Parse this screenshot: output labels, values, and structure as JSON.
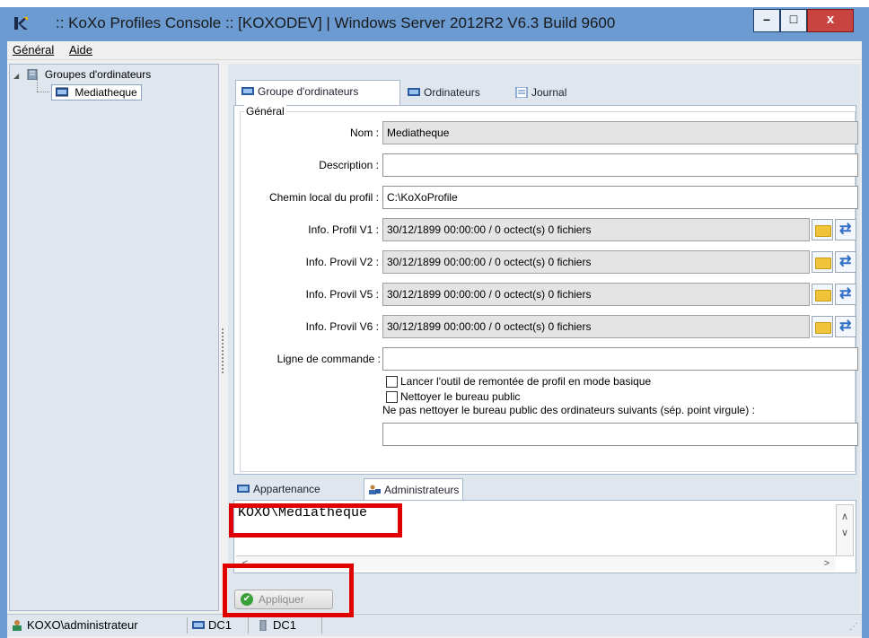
{
  "window": {
    "title": ":: KoXo Profiles Console :: [KOXODEV]  | Windows Server 2012R2 V6.3 Build 9600",
    "min_glyph": "–",
    "max_glyph": "□",
    "close_glyph": "x"
  },
  "menu": [
    {
      "label": "Général"
    },
    {
      "label": "Aide"
    }
  ],
  "tree": {
    "root_label": "Groupes d'ordinateurs",
    "child_label": "Mediatheque",
    "expander": "◢"
  },
  "tabs": [
    {
      "label": "Groupe d'ordinateurs",
      "icon": "computer-group-icon"
    },
    {
      "label": "Ordinateurs",
      "icon": "computers-icon"
    },
    {
      "label": "Journal",
      "icon": "journal-icon"
    }
  ],
  "form": {
    "group_title": "Général",
    "nom_label": "Nom :",
    "nom_value": "Mediatheque",
    "description_label": "Description :",
    "description_value": "",
    "chemin_label": "Chemin local du profil :",
    "chemin_value": "C:\\KoXoProfile",
    "info_rows": [
      {
        "label": "Info. Profil V1 :",
        "value": "30/12/1899 00:00:00 / 0 octect(s)  0 fichiers"
      },
      {
        "label": "Info. Provil V2 :",
        "value": "30/12/1899 00:00:00 / 0 octect(s)  0 fichiers"
      },
      {
        "label": "Info. Provil V5 :",
        "value": "30/12/1899 00:00:00 / 0 octect(s)  0 fichiers"
      },
      {
        "label": "Info. Provil V6 :",
        "value": "30/12/1899 00:00:00 / 0 octect(s)  0 fichiers"
      }
    ],
    "ligne_label": "Ligne de commande :",
    "ligne_value": "",
    "check1_label": "Lancer l'outil de remontée de profil en mode basique",
    "check2_label": "Nettoyer le bureau public",
    "exclude_label": "Ne pas nettoyer le bureau public des ordinateurs suivants (sép. point virgule)  :",
    "exclude_value": ""
  },
  "bottom_tabs": [
    {
      "label": "Appartenance"
    },
    {
      "label": "Administrateurs"
    }
  ],
  "admin_list": {
    "entry": "KOXO\\Mediatheque",
    "up": "∧",
    "down": "∨",
    "left": "<",
    "right": ">"
  },
  "apply_button": {
    "label": "Appliquer",
    "check": "✔"
  },
  "status": {
    "user": "KOXO\\administrateur",
    "dc_a": "DC1",
    "dc_b": "DC1",
    "grip": "⋰"
  },
  "colors": {
    "title_bg": "#6b9bd1",
    "close_bg": "#c74440",
    "panel_bg": "#dfe6ee",
    "highlight": "#e00000"
  }
}
